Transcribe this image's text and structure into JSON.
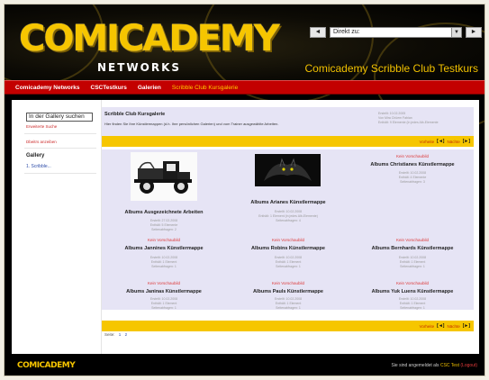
{
  "header": {
    "logo_main": "COMICADEMY",
    "logo_sub": "NETWORKS",
    "title": "Comicademy Scribble Club Testkurs",
    "jump_label": "Direkt zu:",
    "prev_arrow": "◄",
    "next_arrow": "►",
    "select_arrow": "▼"
  },
  "nav": {
    "items": [
      "Comicademy Networks",
      "CSCTestkurs",
      "Galerien",
      "Scribble Club Kursgalerie"
    ]
  },
  "sidebar": {
    "search_value": "In der Gallery suchen",
    "advanced_search": "Erweiterte Suche",
    "subscribe": "Dbeitrs anzeiben",
    "gallery_heading": "Gallery",
    "gallery_item": "1. Scribble..."
  },
  "intro": {
    "title": "Scribble Club Kursgalerie",
    "description": "Hier finden Sie Ihre Künstlermappen (d.h. Ihre persönlichen Galerien) und vom Trainer ausgewählte Arbeiten.",
    "meta": [
      "Erstellt: 10.02.2005",
      "Von Mira Chüem Fabian",
      "Enthält: 9 Elemente (in jedes Alb-Elemente"
    ]
  },
  "pager": {
    "prev": "Vorheite",
    "prev_icon": "[◄]",
    "next": "Nächte",
    "next_icon": "[►]"
  },
  "albums": [
    {
      "thumb": "truck-image",
      "name": "Albums Ausgezeichnete Arbeiten",
      "meta": [
        "Erstellt: 27.02.2008",
        "Enthält: 5 Elemente",
        "Seitenabfragen: 2"
      ]
    },
    {
      "thumb": "dark-creature-image",
      "name": "Albums Arianes Künstlermappe",
      "meta": [
        "Erstellt: 10.02.2008",
        "Enthält: 1 Element (in jedes Alb-Elemente)",
        "Seitenabfragen: 4"
      ]
    },
    {
      "thumb": "Kein Vorschaubild",
      "name": "Albums Christianes Künstlermappe",
      "meta": [
        "Erstellt: 10.02.2008",
        "Enthält: 4 Elemente",
        "Seitenabfragen: 3"
      ]
    },
    {
      "thumb": "Kein Vorschaubild",
      "name": "Albums Jannines Künstlermappe",
      "meta": [
        "Erstellt: 10.02.2008",
        "Enthält: 1 Element",
        "Seitenabfragen: 1"
      ]
    },
    {
      "thumb": "Kein Vorschaubild",
      "name": "Albums Robins Künstlermappe",
      "meta": [
        "Erstellt: 10.02.2008",
        "Enthält: 1 Element",
        "Seitenabfragen: 1"
      ]
    },
    {
      "thumb": "Kein Vorschaubild",
      "name": "Albums Bernhards Künstlermappe",
      "meta": [
        "Erstellt: 10.02.2008",
        "Enthält: 1 Element",
        "Seitenabfragen: 1"
      ]
    },
    {
      "thumb": "Kein Vorschaubild",
      "name": "Albums Janinas Künstlermappe",
      "meta": [
        "Erstellt: 10.02.2008",
        "Enthält: 1 Element",
        "Seitenabfragen: 1"
      ]
    },
    {
      "thumb": "Kein Vorschaubild",
      "name": "Albums Pauls Künstlermappe",
      "meta": [
        "Erstellt: 10.02.2008",
        "Enthält: 1 Element",
        "Seitenabfragen: 1"
      ]
    },
    {
      "thumb": "Kein Vorschaubild",
      "name": "Albums Yuk Luens Künstlermappe",
      "meta": [
        "Erstellt: 10.02.2008",
        "Enthält: 1 Element",
        "Seitenabfragen: 1"
      ]
    }
  ],
  "page_nav": {
    "label": "Seite:",
    "p1": "1",
    "p2": "2"
  },
  "footer": {
    "logo": "COMICADEMY",
    "status_prefix": "Sie sind angemeldet als",
    "user": "CSC Test",
    "logout": "(Logout)"
  },
  "colors": {
    "accent_yellow": "#f6c600",
    "nav_red": "#c30000",
    "panel_lavender": "#e6e4f5"
  }
}
